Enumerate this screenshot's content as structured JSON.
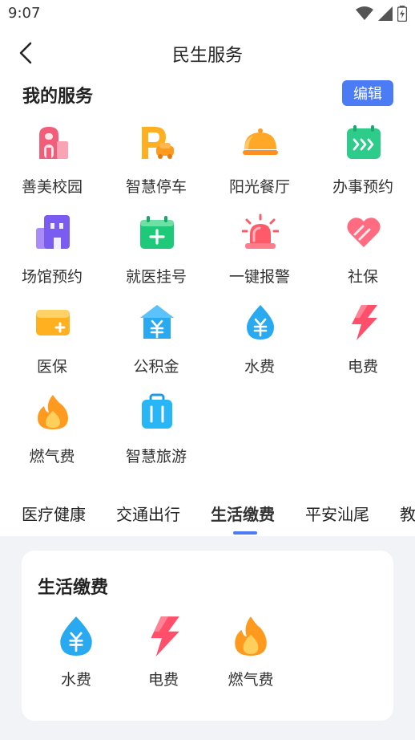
{
  "status_bar": {
    "time": "9:07"
  },
  "header": {
    "title": "民生服务"
  },
  "my_services": {
    "title": "我的服务",
    "edit_label": "编辑",
    "items": [
      {
        "label": "善美校园",
        "icon": "campus-building-icon"
      },
      {
        "label": "智慧停车",
        "icon": "parking-icon"
      },
      {
        "label": "阳光餐厅",
        "icon": "dining-cloche-icon"
      },
      {
        "label": "办事预约",
        "icon": "calendar-icon"
      },
      {
        "label": "场馆预约",
        "icon": "venue-building-icon"
      },
      {
        "label": "就医挂号",
        "icon": "medical-register-icon"
      },
      {
        "label": "一键报警",
        "icon": "alarm-siren-icon"
      },
      {
        "label": "社保",
        "icon": "heart-icon"
      },
      {
        "label": "医保",
        "icon": "medical-insurance-card-icon"
      },
      {
        "label": "公积金",
        "icon": "housing-fund-icon"
      },
      {
        "label": "水费",
        "icon": "water-drop-icon"
      },
      {
        "label": "电费",
        "icon": "lightning-icon"
      },
      {
        "label": "燃气费",
        "icon": "flame-icon"
      },
      {
        "label": "智慧旅游",
        "icon": "luggage-icon"
      }
    ]
  },
  "tabs": [
    {
      "label": "医疗健康"
    },
    {
      "label": "交通出行"
    },
    {
      "label": "生活缴费",
      "active": true
    },
    {
      "label": "平安汕尾"
    },
    {
      "label": "教"
    }
  ],
  "category_panel": {
    "title": "生活缴费",
    "items": [
      {
        "label": "水费",
        "icon": "water-drop-icon"
      },
      {
        "label": "电费",
        "icon": "lightning-icon"
      },
      {
        "label": "燃气费",
        "icon": "flame-icon"
      }
    ]
  },
  "colors": {
    "accent": "#4b7bf5",
    "page_bg": "#f2f3f7"
  }
}
